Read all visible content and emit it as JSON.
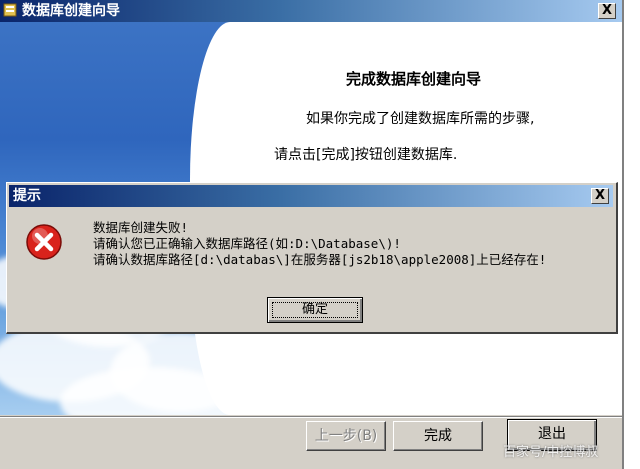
{
  "wizard": {
    "title": "数据库创建向导",
    "close_label": "X",
    "heading": "完成数据库创建向导",
    "line1": "如果你完成了创建数据库所需的步骤,",
    "line2": "请点击[完成]按钮创建数据库.",
    "buttons": {
      "back": "上一步(B)",
      "finish": "完成",
      "exit": "退出"
    }
  },
  "dialog": {
    "title": "提示",
    "close_label": "X",
    "messages": [
      "数据库创建失败!",
      "请确认您已正确输入数据库路径(如:D:\\Database\\)!",
      "请确认数据库路径[d:\\databas\\]在服务器[js2b18\\apple2008]上已经存在!"
    ],
    "ok_label": "确定",
    "icon": "error-icon"
  },
  "watermark": "百家号/中控博叔",
  "colors": {
    "titlebar": "#0a246a",
    "error": "#d9231c",
    "face": "#d4d0c8"
  }
}
